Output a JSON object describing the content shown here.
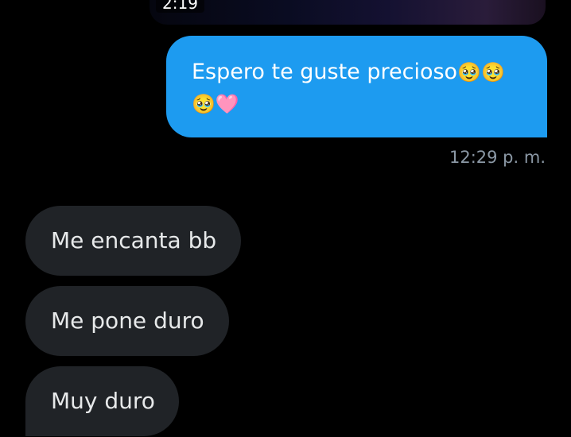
{
  "conversation": {
    "media": {
      "duration": "2:19"
    },
    "sent_message": {
      "text": "Espero te guste precioso",
      "emojis": "🥹🥹🥹🩷",
      "timestamp": "12:29 p. m."
    },
    "received_messages": [
      {
        "text": "Me encanta bb"
      },
      {
        "text": "Me pone duro"
      },
      {
        "text": "Muy duro"
      }
    ]
  },
  "colors": {
    "background": "#000000",
    "sent_bubble": "#1d9bf0",
    "received_bubble": "#202327",
    "timestamp": "#8b98a5"
  }
}
